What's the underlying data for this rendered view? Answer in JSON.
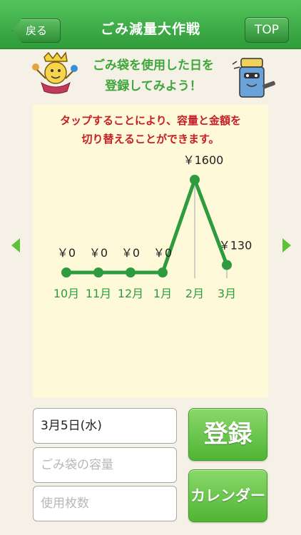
{
  "nav": {
    "title": "ごみ減量大作戦",
    "back_label": "戻る",
    "top_label": "TOP"
  },
  "banner": {
    "line1": "ごみ袋を使用した日を",
    "line2": "登録してみよう！"
  },
  "panel": {
    "note_line1": "タップすることにより、容量と金額を",
    "note_line2": "切り替えることができます。"
  },
  "chart_data": {
    "type": "line",
    "categories": [
      "10月",
      "11月",
      "12月",
      "1月",
      "2月",
      "3月"
    ],
    "values": [
      0,
      0,
      0,
      0,
      1600,
      130
    ],
    "data_labels": [
      "￥0",
      "￥0",
      "￥0",
      "￥0",
      "￥1600",
      "￥130"
    ],
    "ylim": [
      0,
      1600
    ],
    "grid": false,
    "series_color": "#2e9b3e",
    "label_color": "#2e9b3e"
  },
  "form": {
    "date_value": "3月5日(水)",
    "capacity_placeholder": "ごみ袋の容量",
    "count_placeholder": "使用枚数"
  },
  "buttons": {
    "register_label": "登録",
    "calendar_label": "カレンダー"
  },
  "colors": {
    "nav_green": "#3aa843",
    "accent_green": "#2e9b3e",
    "note_red": "#c41f24"
  }
}
